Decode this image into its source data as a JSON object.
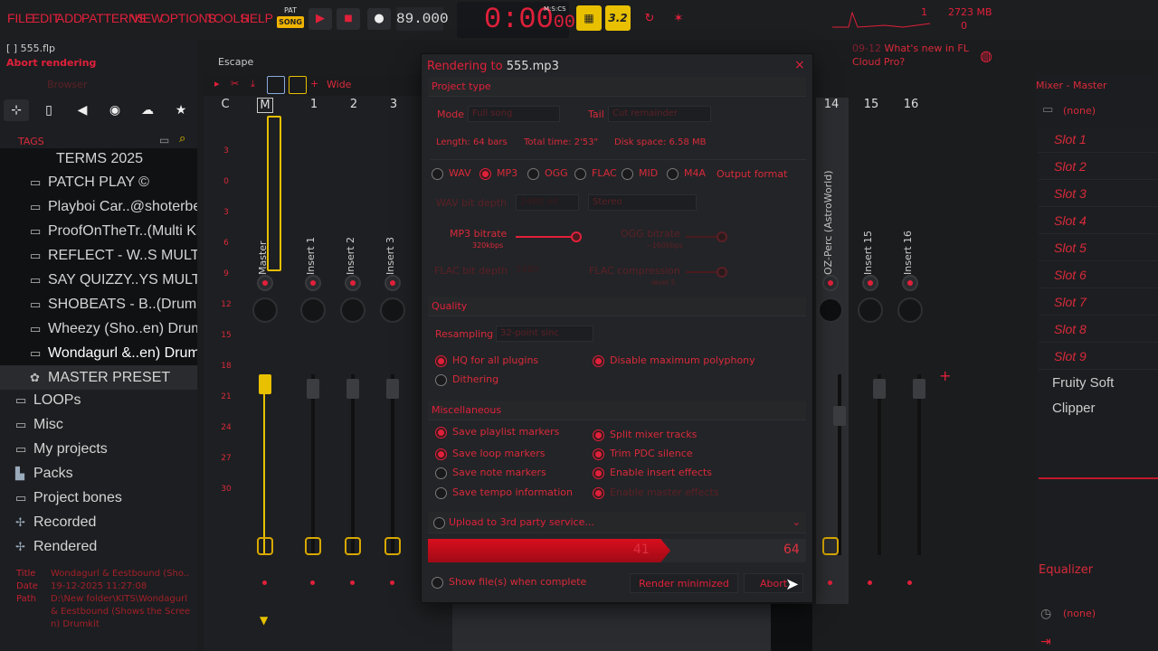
{
  "menu": {
    "file": "FILE",
    "edit": "EDIT",
    "add": "ADD",
    "patterns": "PATTERNS",
    "view": "VIEW",
    "options": "OPTIONS",
    "tools": "TOOLS",
    "help": "HELP"
  },
  "transport": {
    "pat": "PAT",
    "song": "SONG",
    "tempo": "89.000",
    "time": "0:00",
    "time_sub": "00",
    "time_mode": "M:S:CS",
    "pattern_num": "3.2"
  },
  "cpu": {
    "voices": "1",
    "memory": "2723 MB",
    "cpu": "0"
  },
  "news": {
    "date": "09-12",
    "text": "What's new in FL",
    "text2": "Cloud Pro?"
  },
  "project": {
    "file": "[  ] 555.flp",
    "status": "Abort rendering",
    "escape": "Escape",
    "browser": "Browser"
  },
  "browser": {
    "tags": "TAGS",
    "partial": "TERMS 2025",
    "items": [
      {
        "label": "PATCH PLAY ©"
      },
      {
        "label": "Playboi Car..@shoterbeatz"
      },
      {
        "label": "ProofOnTheTr..(Multi Kit)"
      },
      {
        "label": "REFLECT - W..S MULTI KIT"
      },
      {
        "label": "SAY QUIZZY..YS MULTI KIT"
      },
      {
        "label": "SHOBEATS - B..(Drumkits)"
      },
      {
        "label": "Wheezy (Sho..en) Drumkit"
      },
      {
        "label": "Wondagurl &..en) Drumkit"
      },
      {
        "label": "MASTER PRESET"
      },
      {
        "label": "LOOPs"
      },
      {
        "label": "Misc"
      },
      {
        "label": "My projects"
      },
      {
        "label": "Packs"
      },
      {
        "label": "Project bones"
      },
      {
        "label": "Recorded"
      },
      {
        "label": "Rendered"
      }
    ],
    "meta": {
      "title_k": "Title",
      "title_v": "Wondagurl & Eestbound (Sho..",
      "date_k": "Date",
      "date_v": "19-12-2025 11:27:08",
      "path_k": "Path",
      "path_v1": "D:\\New folder\\KITS\\Wondagurl",
      "path_v2": "& Eestbound (Shows the Scree",
      "path_v3": "n) Drumkit"
    }
  },
  "mixer": {
    "view": "Wide",
    "channels": [
      "C",
      "M",
      "1",
      "2",
      "3",
      "14",
      "15",
      "16"
    ],
    "strips": [
      {
        "name": "Master"
      },
      {
        "name": "Insert 1"
      },
      {
        "name": "Insert 2"
      },
      {
        "name": "Insert 3"
      },
      {
        "name": "OZ-Perc (AstroWorld)"
      },
      {
        "name": "Insert 15"
      },
      {
        "name": "Insert 16"
      }
    ],
    "db": [
      "3",
      "0",
      "3",
      "6",
      "9",
      "12",
      "15",
      "18",
      "21",
      "24",
      "27",
      "30"
    ]
  },
  "right_panel": {
    "title": "Mixer - Master",
    "none": "(none)",
    "slots": [
      "Slot 1",
      "Slot 2",
      "Slot 3",
      "Slot 4",
      "Slot 5",
      "Slot 6",
      "Slot 7",
      "Slot 8",
      "Slot 9"
    ],
    "plugin": "Fruity Soft Clipper",
    "equalizer": "Equalizer",
    "none2": "(none)"
  },
  "dialog": {
    "title_prefix": "Rendering to ",
    "title_file": "555.mp3",
    "close": "×",
    "project_type": "Project type",
    "mode_label": "Mode",
    "mode_value": "Full song",
    "tail_label": "Tail",
    "tail_value": "Cut remainder",
    "length": "Length: 64 bars",
    "total_time": "Total time: 2'53\"",
    "disk_space": "Disk space: 6.58 MB",
    "formats": [
      {
        "label": "WAV",
        "on": false
      },
      {
        "label": "MP3",
        "on": true
      },
      {
        "label": "OGG",
        "on": false
      },
      {
        "label": "FLAC",
        "on": false
      },
      {
        "label": "MID",
        "on": false
      },
      {
        "label": "M4A",
        "on": false
      }
    ],
    "output_format": "Output format",
    "wav_bit_depth": "WAV bit depth",
    "wav_bit_value": "24Bit int",
    "stereo": "Stereo",
    "mp3_bitrate": "MP3 bitrate",
    "mp3_value": "320kbps",
    "mp3_level": 0.98,
    "ogg_bitrate": "OGG bitrate",
    "ogg_value": "~160kbps",
    "flac_bit_depth": "FLAC bit depth",
    "flac_bit_value": "24Bit",
    "flac_compression": "FLAC compression",
    "flac_comp_value": "level 5",
    "quality": "Quality",
    "resampling_label": "Resampling",
    "resampling_value": "32-point sinc",
    "q_opts": [
      {
        "label": "HQ for all plugins",
        "on": true
      },
      {
        "label": "Disable maximum polyphony",
        "on": true
      },
      {
        "label": "Dithering",
        "on": false
      }
    ],
    "misc": "Miscellaneous",
    "misc_left": [
      {
        "label": "Save playlist markers",
        "on": true
      },
      {
        "label": "Save loop markers",
        "on": true
      },
      {
        "label": "Save note markers",
        "on": false
      },
      {
        "label": "Save tempo information",
        "on": false
      }
    ],
    "misc_right": [
      {
        "label": "Split mixer tracks",
        "on": true
      },
      {
        "label": "Trim PDC silence",
        "on": true
      },
      {
        "label": "Enable insert effects",
        "on": true
      },
      {
        "label": "Enable master effects",
        "on": true
      }
    ],
    "upload": "Upload to 3rd party service...",
    "progress_current": "41",
    "progress_total": "64",
    "progress_fraction": 0.64,
    "show_files": "Show file(s) when complete",
    "render_minimized": "Render minimized",
    "abort": "Abort"
  },
  "colors": {
    "accent": "#e0203a",
    "bg": "#1b1c1e",
    "yellow": "#e8c000",
    "panel": "#232427"
  },
  "icons": [
    "play-icon",
    "stop-icon",
    "record-icon",
    "cpu-graph-icon",
    "close-icon",
    "folder-icon",
    "search-icon",
    "star-icon",
    "cloud-icon",
    "globe-icon"
  ]
}
